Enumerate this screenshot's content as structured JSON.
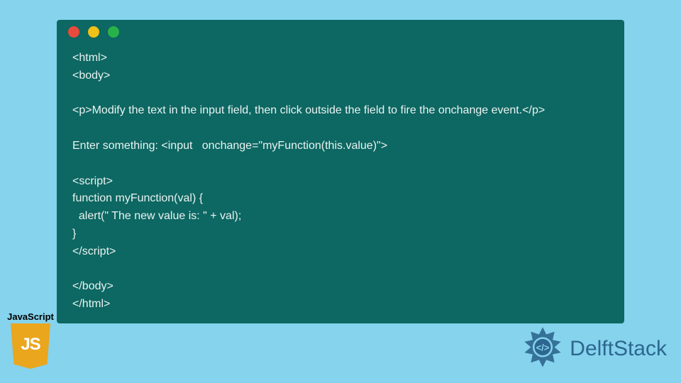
{
  "window": {
    "dots": [
      "red",
      "yellow",
      "green"
    ]
  },
  "code": {
    "lines": [
      "<html>",
      "<body>",
      "",
      "<p>Modify the text in the input field, then click outside the field to fire the onchange event.</p>",
      "",
      "Enter something: <input   onchange=\"myFunction(this.value)\">",
      "",
      "<script>",
      "function myFunction(val) {",
      "  alert(\" The new value is: \" + val);",
      "}",
      "</script>",
      "",
      "</body>",
      "</html>"
    ]
  },
  "js_badge": {
    "label": "JavaScript",
    "icon_text": "JS"
  },
  "brand": {
    "name": "DelftStack"
  }
}
